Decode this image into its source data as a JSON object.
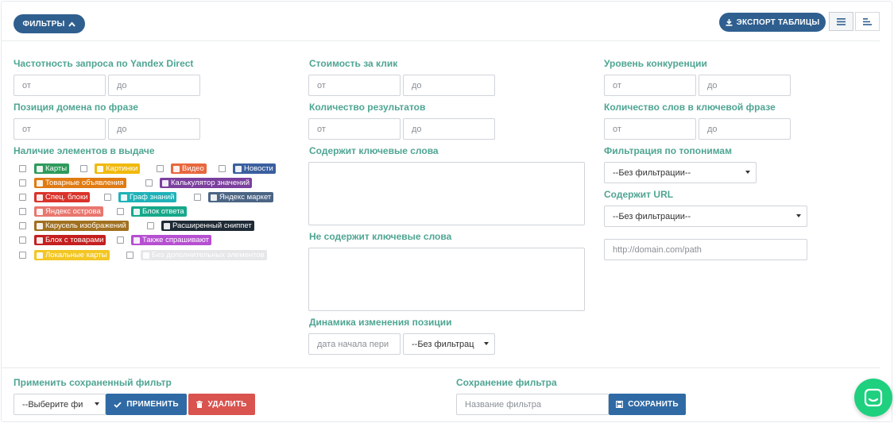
{
  "toolbar": {
    "filters_label": "ФИЛЬТРЫ",
    "export_label": "ЭКСПОРТ ТАБЛИЦЫ"
  },
  "filters": {
    "freq": {
      "label": "Частотность запроса по Yandex Direct",
      "from": "от",
      "to": "до"
    },
    "cpc": {
      "label": "Стоимость за клик",
      "from": "от",
      "to": "до"
    },
    "competition": {
      "label": "Уровень конкуренции",
      "from": "от",
      "to": "до"
    },
    "position": {
      "label": "Позиция домена по фразе",
      "from": "от",
      "to": "до"
    },
    "results": {
      "label": "Количество результатов",
      "from": "от",
      "to": "до"
    },
    "words": {
      "label": "Количество слов в ключевой фразе",
      "from": "от",
      "to": "до"
    },
    "serp_label": "Наличие элементов в выдаче",
    "contains_label": "Содержит ключевые слова",
    "not_contains_label": "Не содержит ключевые слова",
    "dynamics": {
      "label": "Динамика изменения позиции",
      "date_placeholder": "дата начала пери",
      "select_value": "--Без фильтрац"
    },
    "toponym": {
      "label": "Фильтрация по топонимам",
      "value": "--Без фильтрации--"
    },
    "url": {
      "label": "Содержит URL",
      "value": "--Без фильтрации--",
      "placeholder": "http://domain.com/path"
    }
  },
  "serp_items": [
    {
      "label": "Карты",
      "color": "#2e9b5b"
    },
    {
      "label": "Картинки",
      "color": "#f0b90b"
    },
    {
      "label": "Видео",
      "color": "#e8673d"
    },
    {
      "label": "Новости",
      "color": "#3a5f9f"
    },
    {
      "label": "Товарные объявления",
      "color": "#e07b12"
    },
    {
      "label": "Калькулятор значений",
      "color": "#7b3f9e"
    },
    {
      "label": "Спец. блоки",
      "color": "#d9332b"
    },
    {
      "label": "Граф знаний",
      "color": "#1fb2b8"
    },
    {
      "label": "Яндекс маркет",
      "color": "#4b6584"
    },
    {
      "label": "Яндекс острова",
      "color": "#e8776f"
    },
    {
      "label": "Блок ответа",
      "color": "#17a88a"
    },
    {
      "label": "Карусель изображений",
      "color": "#a1701f"
    },
    {
      "label": "Расширенный сниппет",
      "color": "#1e2a35"
    },
    {
      "label": "Блок с товарами",
      "color": "#c41f1f"
    },
    {
      "label": "Также спрашивают",
      "color": "#b64fd1"
    },
    {
      "label": "Локальные карты",
      "color": "#f3c623"
    },
    {
      "label": "Без дополнительных элементов",
      "color": "#c8cbd0"
    }
  ],
  "bottom": {
    "saved_label": "Применить сохраненный фильтр",
    "saved_select": "--Выберите фи",
    "apply_label": "ПРИМЕНИТЬ",
    "delete_label": "УДАЛИТЬ",
    "save_section_label": "Сохранение фильтра",
    "filter_name_placeholder": "Название фильтра",
    "save_label": "СОХРАНИТЬ"
  },
  "colors": {
    "primary": "#2f5f8f",
    "label_green": "#4fa593",
    "danger": "#d9534f",
    "chat": "#1fd07f"
  }
}
